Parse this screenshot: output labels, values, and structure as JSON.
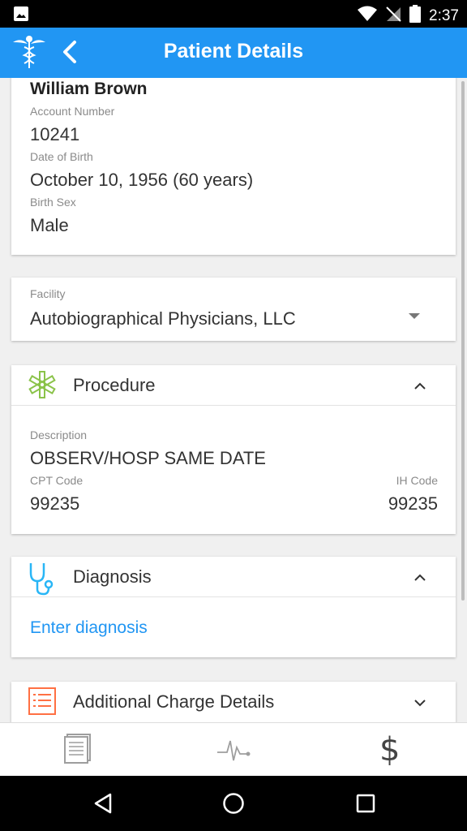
{
  "status_bar": {
    "time": "2:37"
  },
  "app_bar": {
    "title": "Patient Details"
  },
  "patient": {
    "name": "William Brown",
    "account_label": "Account Number",
    "account_value": "10241",
    "dob_label": "Date of Birth",
    "dob_value": "October 10, 1956 (60 years)",
    "sex_label": "Birth Sex",
    "sex_value": "Male"
  },
  "facility": {
    "label": "Facility",
    "value": "Autobiographical Physicians, LLC"
  },
  "procedure": {
    "title": "Procedure",
    "description_label": "Description",
    "description_value": "OBSERV/HOSP SAME DATE",
    "cpt_label": "CPT Code",
    "cpt_value": "99235",
    "ih_label": "IH Code",
    "ih_value": "99235"
  },
  "diagnosis": {
    "title": "Diagnosis",
    "link": "Enter diagnosis"
  },
  "additional": {
    "title": "Additional Charge Details"
  },
  "bottom_nav": {
    "dollar_symbol": "$"
  },
  "colors": {
    "primary": "#2196f3",
    "procedure_icon": "#8bc34a",
    "diagnosis_icon": "#29b6f6",
    "additional_icon": "#ff7043"
  }
}
